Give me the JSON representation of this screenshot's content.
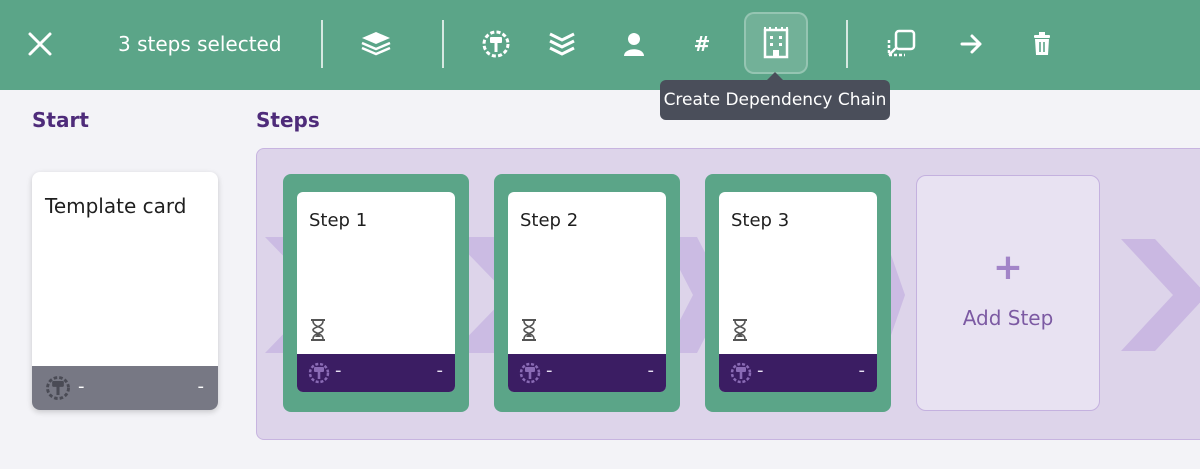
{
  "toolbar": {
    "selected_text": "3 steps selected",
    "icons": [
      "close-icon",
      "stack-icon",
      "hammer-gear-icon",
      "layers-icon",
      "user-icon",
      "hash-icon",
      "dependency-chain-icon",
      "move-to-icon",
      "arrow-right-icon",
      "trash-icon"
    ],
    "hash_label": "#",
    "active_tool": "dependency-chain",
    "tooltip": "Create Dependency Chain"
  },
  "start": {
    "heading": "Start",
    "template_card": {
      "title": "Template card",
      "footer_left": "-",
      "footer_right": "-"
    }
  },
  "steps": {
    "heading": "Steps",
    "items": [
      {
        "title": "Step 1",
        "footer_left": "-",
        "footer_right": "-"
      },
      {
        "title": "Step 2",
        "footer_left": "-",
        "footer_right": "-"
      },
      {
        "title": "Step 3",
        "footer_left": "-",
        "footer_right": "-"
      }
    ],
    "add_step": {
      "plus": "+",
      "label": "Add Step"
    }
  },
  "colors": {
    "toolbar_bg": "#5ba588",
    "heading": "#4e2b7a",
    "step_footer": "#3b1d63",
    "lane_bg": "#ddd4ea",
    "tooltip_bg": "#4a4e5a"
  }
}
